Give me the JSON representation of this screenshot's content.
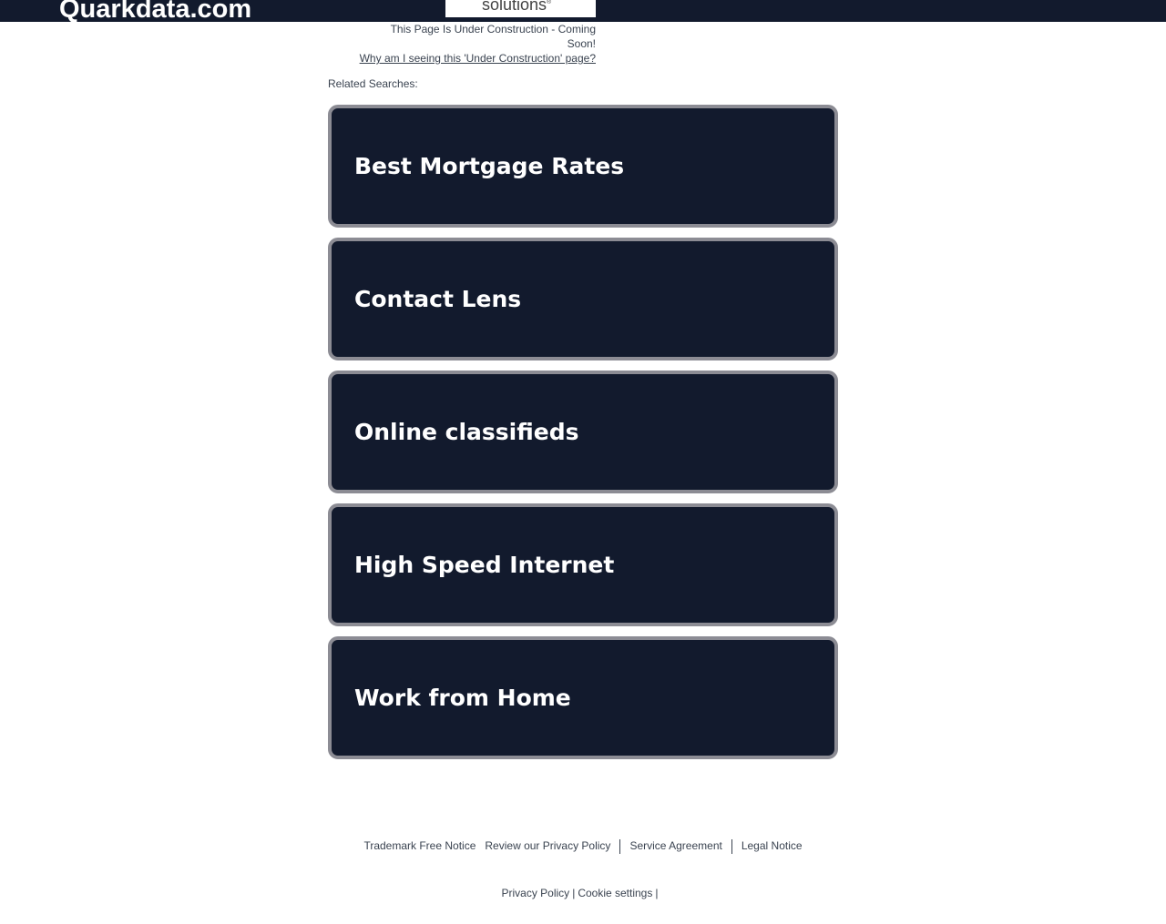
{
  "header": {
    "domain": "Quarkdata.com",
    "logo_text": "solutions",
    "logo_mark": "®"
  },
  "notice": {
    "status": "This Page Is Under Construction - Coming Soon!",
    "why_link": "Why am I seeing this 'Under Construction' page?"
  },
  "related": {
    "label": "Related Searches:",
    "items": [
      "Best Mortgage Rates",
      "Contact Lens",
      "Online classifieds",
      "High Speed Internet",
      "Work from Home"
    ]
  },
  "footer": {
    "trademark": "Trademark Free Notice",
    "privacy_review": "Review our Privacy Policy",
    "service": "Service Agreement",
    "legal": "Legal Notice",
    "privacy": "Privacy Policy",
    "cookie": "Cookie settings",
    "pipe": "|"
  },
  "colors": {
    "header_bg": "#121a2d",
    "card_bg": "#121a2d",
    "card_border": "#8c8c94",
    "text": "#3a4350"
  }
}
